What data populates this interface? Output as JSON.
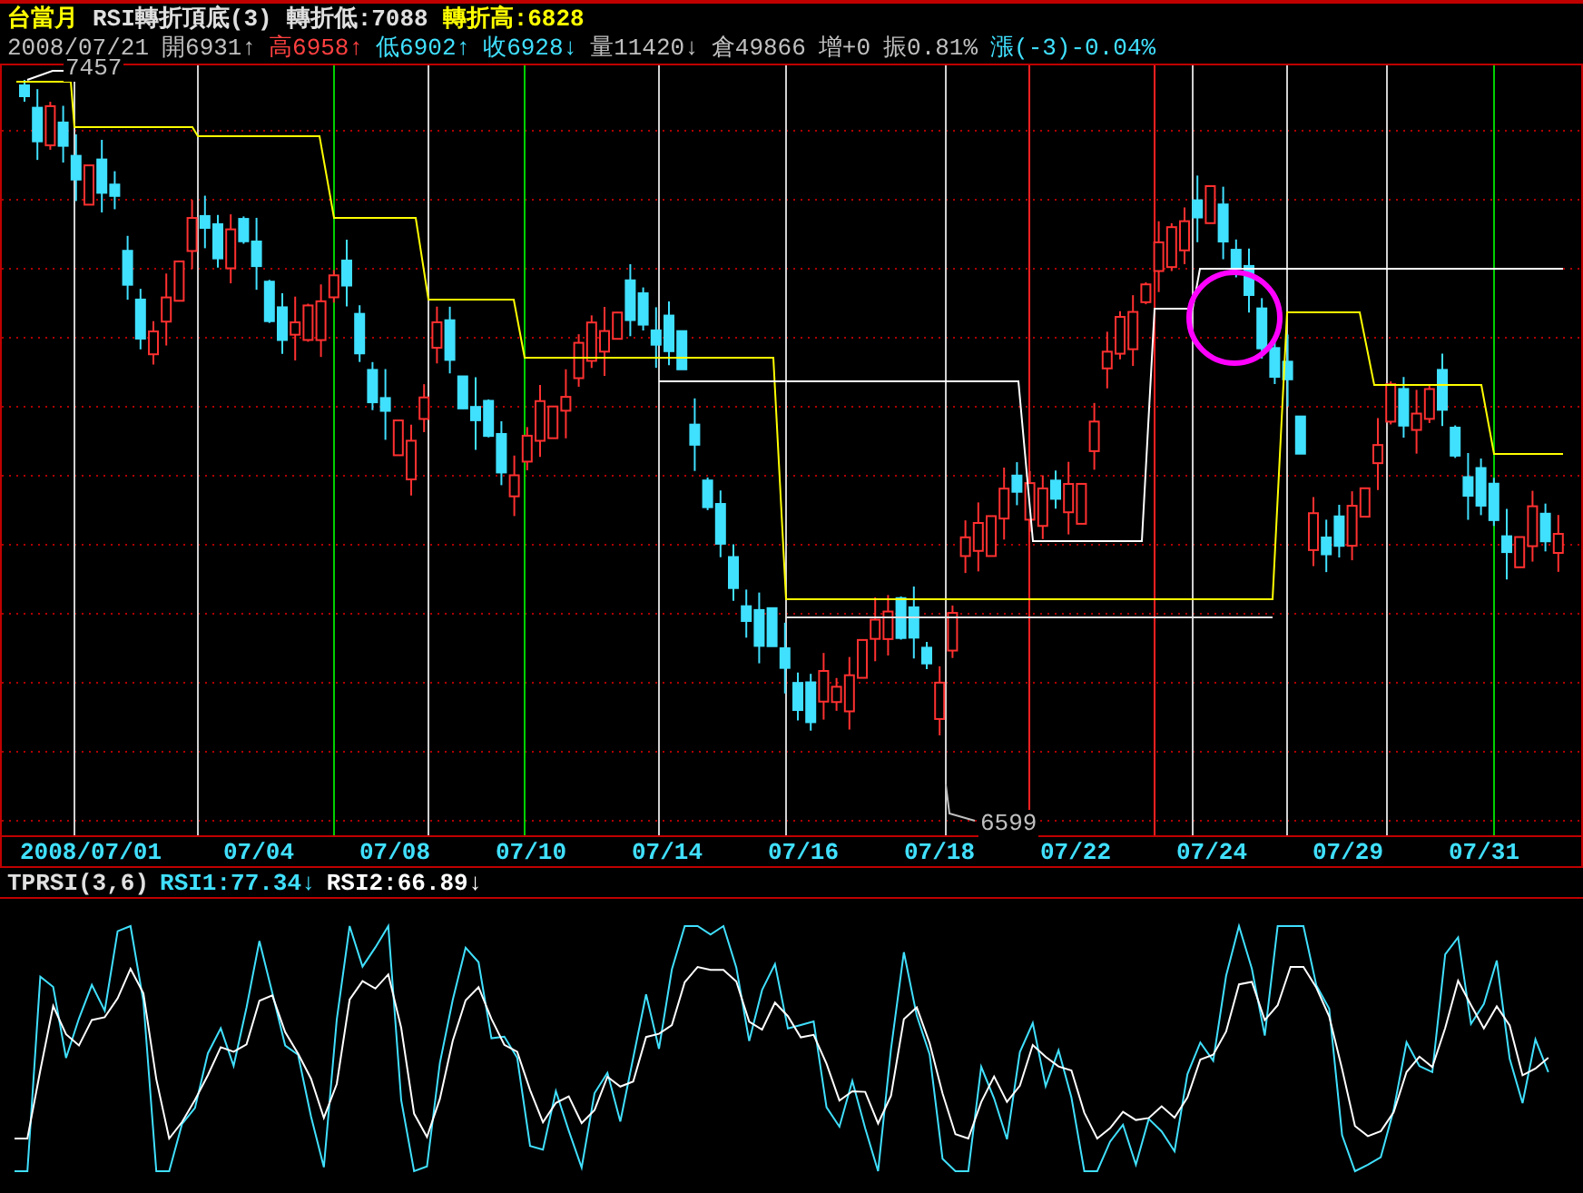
{
  "header": {
    "title": "台當月",
    "indicator": "RSI轉折頂底(3)",
    "turn_low": "轉折低:7088",
    "turn_high": "轉折高:6828"
  },
  "quote": [
    {
      "text": "2008/07/21",
      "color": "#c0c0c0"
    },
    {
      "text": "開6931↑",
      "color": "#c0c0c0"
    },
    {
      "text": "高6958↑",
      "color": "#ff4040"
    },
    {
      "text": "低6902↑",
      "color": "#40e0ff"
    },
    {
      "text": "收6928↓",
      "color": "#40e0ff"
    },
    {
      "text": "量11420↓",
      "color": "#c0c0c0"
    },
    {
      "text": "倉49866",
      "color": "#c0c0c0"
    },
    {
      "text": "增+0",
      "color": "#c0c0c0"
    },
    {
      "text": "振0.81%",
      "color": "#c0c0c0"
    },
    {
      "text": "漲(-3)-0.04%",
      "color": "#40e0ff"
    }
  ],
  "price_chart": {
    "high_label": "7457",
    "low_label": "6599"
  },
  "dates": [
    "2008/07/01",
    "07/04",
    "07/08",
    "07/10",
    "07/14",
    "07/16",
    "07/18",
    "07/22",
    "07/24",
    "07/29",
    "07/31"
  ],
  "rsi_panel": {
    "title": "TPRSI(3,6)",
    "rsi1": "RSI1:77.34↓",
    "rsi2": "RSI2:66.89↓"
  }
}
